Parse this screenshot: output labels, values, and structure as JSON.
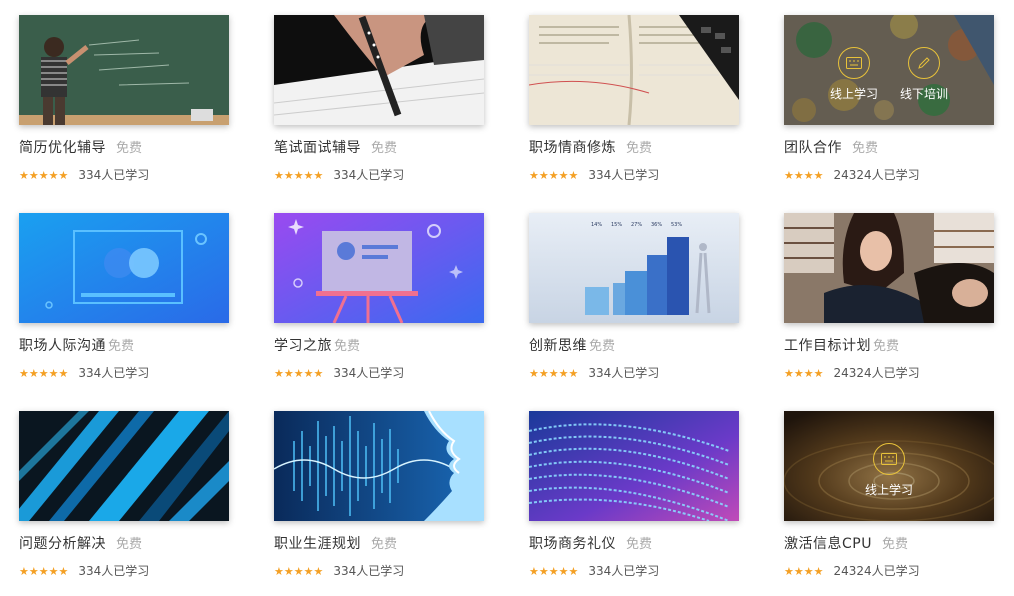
{
  "courses": [
    {
      "title": "简历优化辅导",
      "price": "免费",
      "stars": "★★★★★",
      "learners": "334人已学习"
    },
    {
      "title": "笔试面试辅导",
      "price": "免费",
      "stars": "★★★★★",
      "learners": "334人已学习"
    },
    {
      "title": "职场情商修炼",
      "price": "免费",
      "stars": "★★★★★",
      "learners": "334人已学习"
    },
    {
      "title": "团队合作",
      "price": "免费",
      "stars": "★★★★",
      "learners": "24324人已学习",
      "overlay": {
        "online": "线上学习",
        "offline": "线下培训"
      }
    },
    {
      "title": "职场人际沟通",
      "price": "免费",
      "stars": "★★★★★",
      "learners": "334人已学习"
    },
    {
      "title": "学习之旅",
      "price": "免费",
      "stars": "★★★★★",
      "learners": "334人已学习"
    },
    {
      "title": "创新思维",
      "price": "免费",
      "stars": "★★★★★",
      "learners": "334人已学习",
      "chart_labels": [
        "14%",
        "15%",
        "27%",
        "36%",
        "53%"
      ]
    },
    {
      "title": "工作目标计划",
      "price": "免费",
      "stars": "★★★★",
      "learners": "24324人已学习"
    },
    {
      "title": "问题分析解决",
      "price": "免费",
      "stars": "★★★★★",
      "learners": "334人已学习"
    },
    {
      "title": "职业生涯规划",
      "price": "免费",
      "stars": "★★★★★",
      "learners": "334人已学习"
    },
    {
      "title": "职场商务礼仪",
      "price": "免费",
      "stars": "★★★★★",
      "learners": "334人已学习"
    },
    {
      "title": "激活信息CPU",
      "price": "免费",
      "stars": "★★★★",
      "learners": "24324人已学习",
      "overlay": {
        "online": "线上学习"
      }
    }
  ],
  "colors": {
    "star": "#f4a024",
    "price": "#aaaaaa",
    "title": "#333333",
    "overlay_ring": "#e8c23a"
  }
}
